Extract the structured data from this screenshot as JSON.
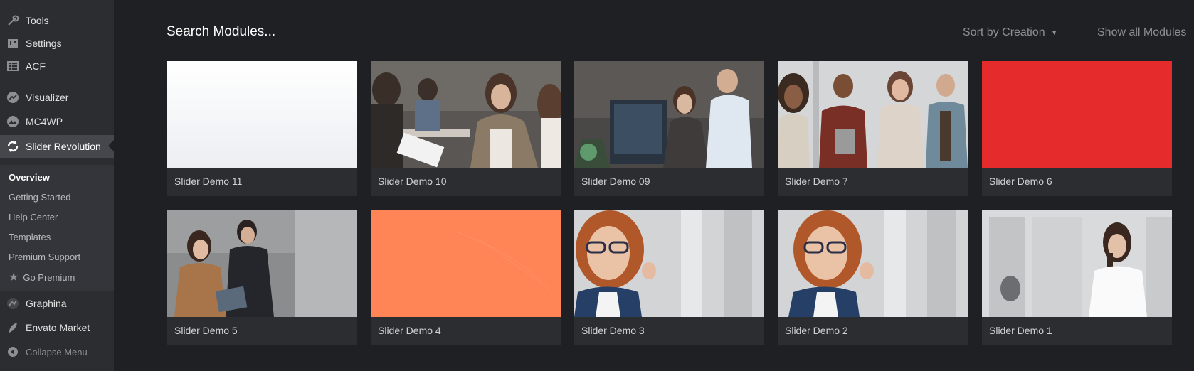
{
  "sidebar": {
    "items": [
      {
        "label": "Tools",
        "icon": "wrench-icon"
      },
      {
        "label": "Settings",
        "icon": "settings-icon"
      },
      {
        "label": "ACF",
        "icon": "table-icon"
      },
      {
        "label": "Visualizer",
        "icon": "chart-icon"
      },
      {
        "label": "MC4WP",
        "icon": "mountain-icon"
      },
      {
        "label": "Slider Revolution",
        "icon": "refresh-icon"
      }
    ],
    "submenu": [
      "Overview",
      "Getting Started",
      "Help Center",
      "Templates",
      "Premium Support",
      "Go Premium"
    ],
    "items_bottom": [
      {
        "label": "Graphina",
        "icon": "graphina-icon"
      },
      {
        "label": "Envato Market",
        "icon": "leaf-icon"
      }
    ],
    "collapse_label": "Collapse Menu"
  },
  "header": {
    "search_label": "Search Modules...",
    "sort_label": "Sort by Creation",
    "show_all_label": "Show all Modules"
  },
  "modules": [
    {
      "title": "Slider Demo 11",
      "thumb": "white-gradient"
    },
    {
      "title": "Slider Demo 10",
      "thumb": "office-meeting"
    },
    {
      "title": "Slider Demo 09",
      "thumb": "office-computers"
    },
    {
      "title": "Slider Demo 7",
      "thumb": "team-group"
    },
    {
      "title": "Slider Demo 6",
      "thumb": "solid-red"
    },
    {
      "title": "Slider Demo 5",
      "thumb": "business-couple"
    },
    {
      "title": "Slider Demo 4",
      "thumb": "solid-orange"
    },
    {
      "title": "Slider Demo 3",
      "thumb": "redhead-woman"
    },
    {
      "title": "Slider Demo 2",
      "thumb": "redhead-woman"
    },
    {
      "title": "Slider Demo 1",
      "thumb": "woman-office"
    }
  ],
  "colors": {
    "background": "#1f2024",
    "sidebar": "#2c2d31",
    "card": "#2c2d31",
    "red": "#e52b2b",
    "orange": "#ff8456"
  }
}
